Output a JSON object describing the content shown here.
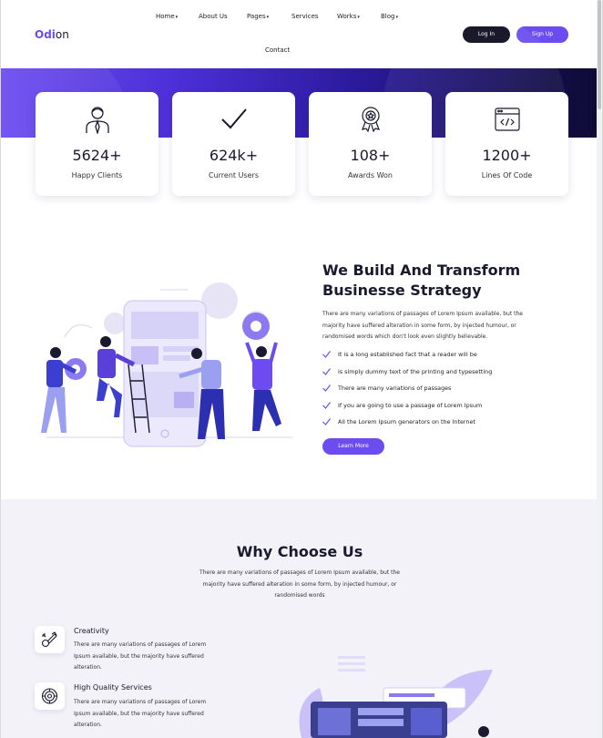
{
  "header": {
    "logo_a": "Odi",
    "logo_b": "on",
    "nav": [
      {
        "label": "Home",
        "dropdown": true
      },
      {
        "label": "About Us",
        "dropdown": false
      },
      {
        "label": "Pages",
        "dropdown": true
      },
      {
        "label": "Services",
        "dropdown": false
      },
      {
        "label": "Works",
        "dropdown": true
      },
      {
        "label": "Blog",
        "dropdown": true
      },
      {
        "label": "Contact",
        "dropdown": false
      }
    ],
    "login_label": "Log In",
    "signup_label": "Sign Up"
  },
  "stats": [
    {
      "icon": "person-icon",
      "value": "5624+",
      "label": "Happy Clients"
    },
    {
      "icon": "checkmark-icon",
      "value": "624k+",
      "label": "Current Users"
    },
    {
      "icon": "award-icon",
      "value": "108+",
      "label": "Awards Won"
    },
    {
      "icon": "code-window-icon",
      "value": "1200+",
      "label": "Lines Of Code"
    }
  ],
  "about": {
    "title_line1": "We Build And Transform",
    "title_line2": "Businesse Strategy",
    "text_line1": "There are many variations of passages of Lorem Ipsum available, but the",
    "text_line2": "majority have suffered alteration in some form, by injected humour, or",
    "text_line3": "randomised words which don't look even slightly believable.",
    "checklist": [
      "It is a long established fact that a reader will be",
      "is simply dummy text of the printing and typesetting",
      "There are many variations of passages",
      "If you are going to use a passage of Lorem Ipsum",
      "All the Lorem Ipsum generators on the Internet"
    ],
    "learn_label": "Learn More"
  },
  "why": {
    "title": "Why Choose Us",
    "text_line1": "There are many variations of passages of Lorem Ipsum available, but the",
    "text_line2": "majority have suffered alteration in some form, by injected humour, or",
    "text_line3": "randomised words",
    "features": [
      {
        "icon": "creativity-icon",
        "title": "Creativity",
        "line1": "There are many variations of passages of Lorem",
        "line2": "Ipsum available, but the majority have suffered",
        "line3": "alteration."
      },
      {
        "icon": "quality-icon",
        "title": "High Quality Services",
        "line1": "There are many variations of passages of Lorem",
        "line2": "Ipsum available, but the majority have suffered",
        "line3": "alteration."
      }
    ]
  },
  "colors": {
    "accent": "#6c4cf1",
    "dark": "#0b0b1e",
    "section_bg": "#f3f2f8"
  }
}
